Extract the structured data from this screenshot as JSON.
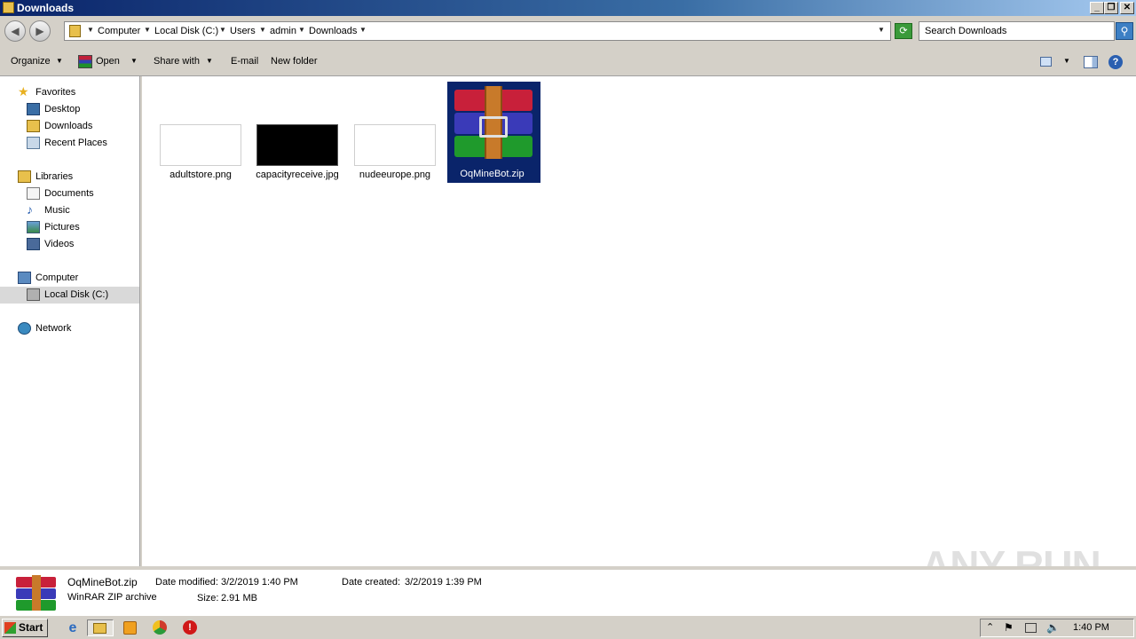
{
  "window": {
    "title": "Downloads"
  },
  "address": {
    "crumbs": [
      "Computer",
      "Local Disk (C:)",
      "Users",
      "admin",
      "Downloads"
    ]
  },
  "search": {
    "placeholder": "Search Downloads"
  },
  "toolbar": {
    "organize": "Organize",
    "open": "Open",
    "share_with": "Share with",
    "email": "E-mail",
    "new_folder": "New folder"
  },
  "sidebar": {
    "favorites": "Favorites",
    "desktop": "Desktop",
    "downloads": "Downloads",
    "recent_places": "Recent Places",
    "libraries": "Libraries",
    "documents": "Documents",
    "music": "Music",
    "pictures": "Pictures",
    "videos": "Videos",
    "computer": "Computer",
    "local_disk": "Local Disk (C:)",
    "network": "Network"
  },
  "files": [
    {
      "name": "adultstore.png"
    },
    {
      "name": "capacityreceive.jpg"
    },
    {
      "name": "nudeeurope.png"
    },
    {
      "name": "OqMineBot.zip"
    }
  ],
  "details": {
    "name": "OqMineBot.zip",
    "type": "WinRAR ZIP archive",
    "date_modified_label": "Date modified:",
    "date_modified": "3/2/2019 1:40 PM",
    "date_created_label": "Date created:",
    "date_created": "3/2/2019 1:39 PM",
    "size_label": "Size:",
    "size": "2.91 MB"
  },
  "taskbar": {
    "start": "Start",
    "clock": "1:40 PM"
  },
  "watermark": "ANY RUN",
  "colors": {
    "selection": "#0a246a",
    "title_start": "#0a246a"
  }
}
